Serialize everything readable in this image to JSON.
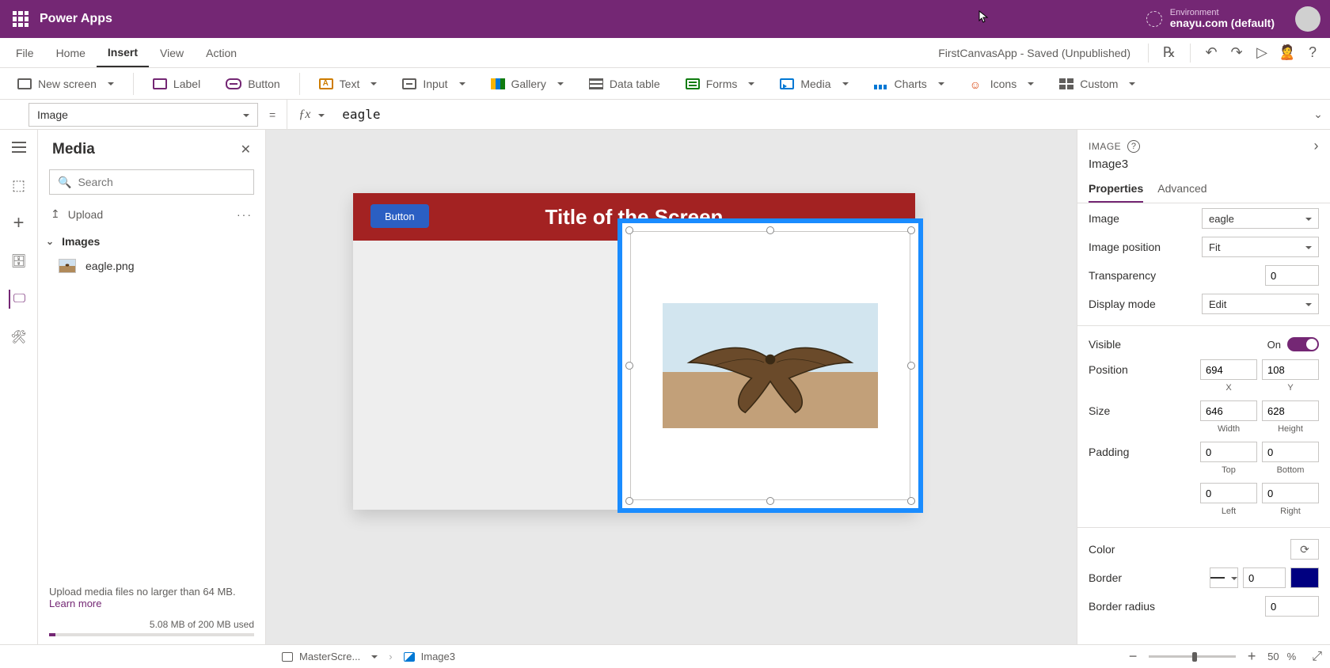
{
  "header": {
    "brand": "Power Apps",
    "environment_label": "Environment",
    "environment_name": "enayu.com (default)"
  },
  "menubar": {
    "items": [
      "File",
      "Home",
      "Insert",
      "View",
      "Action"
    ],
    "active_index": 2,
    "document_title": "FirstCanvasApp - Saved (Unpublished)"
  },
  "ribbon": {
    "new_screen": "New screen",
    "label": "Label",
    "button": "Button",
    "text": "Text",
    "input": "Input",
    "gallery": "Gallery",
    "data_table": "Data table",
    "forms": "Forms",
    "media": "Media",
    "charts": "Charts",
    "icons": "Icons",
    "custom": "Custom"
  },
  "formula_bar": {
    "property": "Image",
    "formula": "eagle"
  },
  "left_panel": {
    "title": "Media",
    "search_placeholder": "Search",
    "upload": "Upload",
    "sections": [
      {
        "name": "Images",
        "items": [
          {
            "name": "eagle.png"
          }
        ]
      }
    ],
    "footer_text": "Upload media files no larger than 64 MB.",
    "footer_link": "Learn more",
    "usage_text": "5.08 MB of 200 MB used"
  },
  "canvas": {
    "screen_title": "Title of the Screen",
    "button_label": "Button"
  },
  "right_panel": {
    "category": "IMAGE",
    "control_name": "Image3",
    "tabs": [
      "Properties",
      "Advanced"
    ],
    "active_tab": 0,
    "props": {
      "image_label": "Image",
      "image_value": "eagle",
      "image_position_label": "Image position",
      "image_position_value": "Fit",
      "transparency_label": "Transparency",
      "transparency_value": "0",
      "display_mode_label": "Display mode",
      "display_mode_value": "Edit",
      "visible_label": "Visible",
      "visible_on": "On",
      "position_label": "Position",
      "position_x": "694",
      "position_y": "108",
      "position_x_sub": "X",
      "position_y_sub": "Y",
      "size_label": "Size",
      "size_w": "646",
      "size_h": "628",
      "size_w_sub": "Width",
      "size_h_sub": "Height",
      "padding_label": "Padding",
      "padding_t": "0",
      "padding_b": "0",
      "padding_l": "0",
      "padding_r": "0",
      "padding_t_sub": "Top",
      "padding_b_sub": "Bottom",
      "padding_l_sub": "Left",
      "padding_r_sub": "Right",
      "color_label": "Color",
      "border_label": "Border",
      "border_value": "0",
      "border_radius_label": "Border radius",
      "border_radius_value": "0"
    }
  },
  "statusbar": {
    "crumb1": "MasterScre...",
    "crumb2": "Image3",
    "zoom": "50",
    "zoom_pct": "%"
  }
}
